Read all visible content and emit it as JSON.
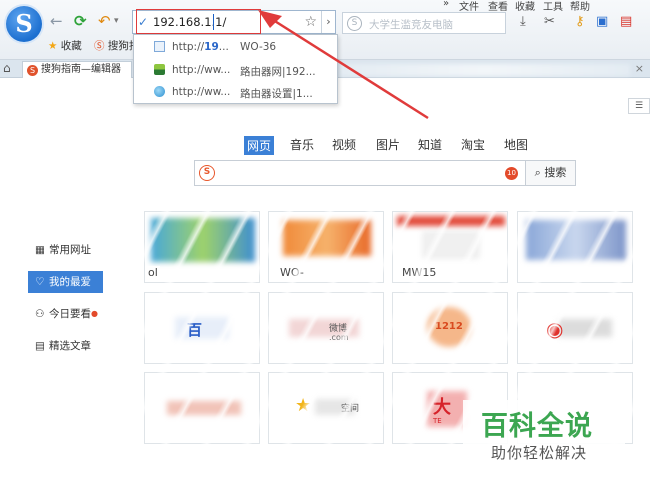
{
  "toolbar": {
    "address_value": "192.168.1.1/",
    "search_placeholder": "大学生滥竞友电脑",
    "menu": [
      "»",
      "文件",
      "查看",
      "收藏",
      "工具",
      "帮助"
    ]
  },
  "favorites": {
    "item1": "收藏",
    "item2": "搜狗捐"
  },
  "tab": {
    "title": "搜狗指南—编辑器"
  },
  "dropdown": [
    {
      "url": "http://19...",
      "title": "WO-36",
      "icon": "page-icon"
    },
    {
      "url": "http://ww...",
      "title": "路由器网|192...",
      "icon": "router-site-icon"
    },
    {
      "url": "http://ww...",
      "title": "路由器设置|1...",
      "icon": "globe-icon"
    }
  ],
  "search_tabs": [
    "网页",
    "音乐",
    "视频",
    "图片",
    "知道",
    "淘宝",
    "地图"
  ],
  "main_search": {
    "badge": "10",
    "button": "搜索"
  },
  "sidebar": [
    {
      "label": "常用网址",
      "icon": "grid-icon"
    },
    {
      "label": "我的最爱",
      "icon": "heart-icon"
    },
    {
      "label": "今日要看",
      "icon": "person-icon"
    },
    {
      "label": "精选文章",
      "icon": "article-icon"
    }
  ],
  "thumbs": {
    "t1_label": "ol",
    "t2_label": "WO-",
    "t3_label": "MW15",
    "logo_baidu": "百",
    "logo_weibo": "微博",
    "logo_weibo_sub": ".com",
    "logo_1212": "1212",
    "logo_space": "空间",
    "logo_da": "大",
    "logo_da_sub": "TE"
  },
  "watermark": {
    "title": "百科全说",
    "subtitle": "助你轻松解决"
  },
  "colors": {
    "accent": "#3b80d6",
    "annotation": "#e03b3b",
    "watermark": "#3ca651"
  }
}
